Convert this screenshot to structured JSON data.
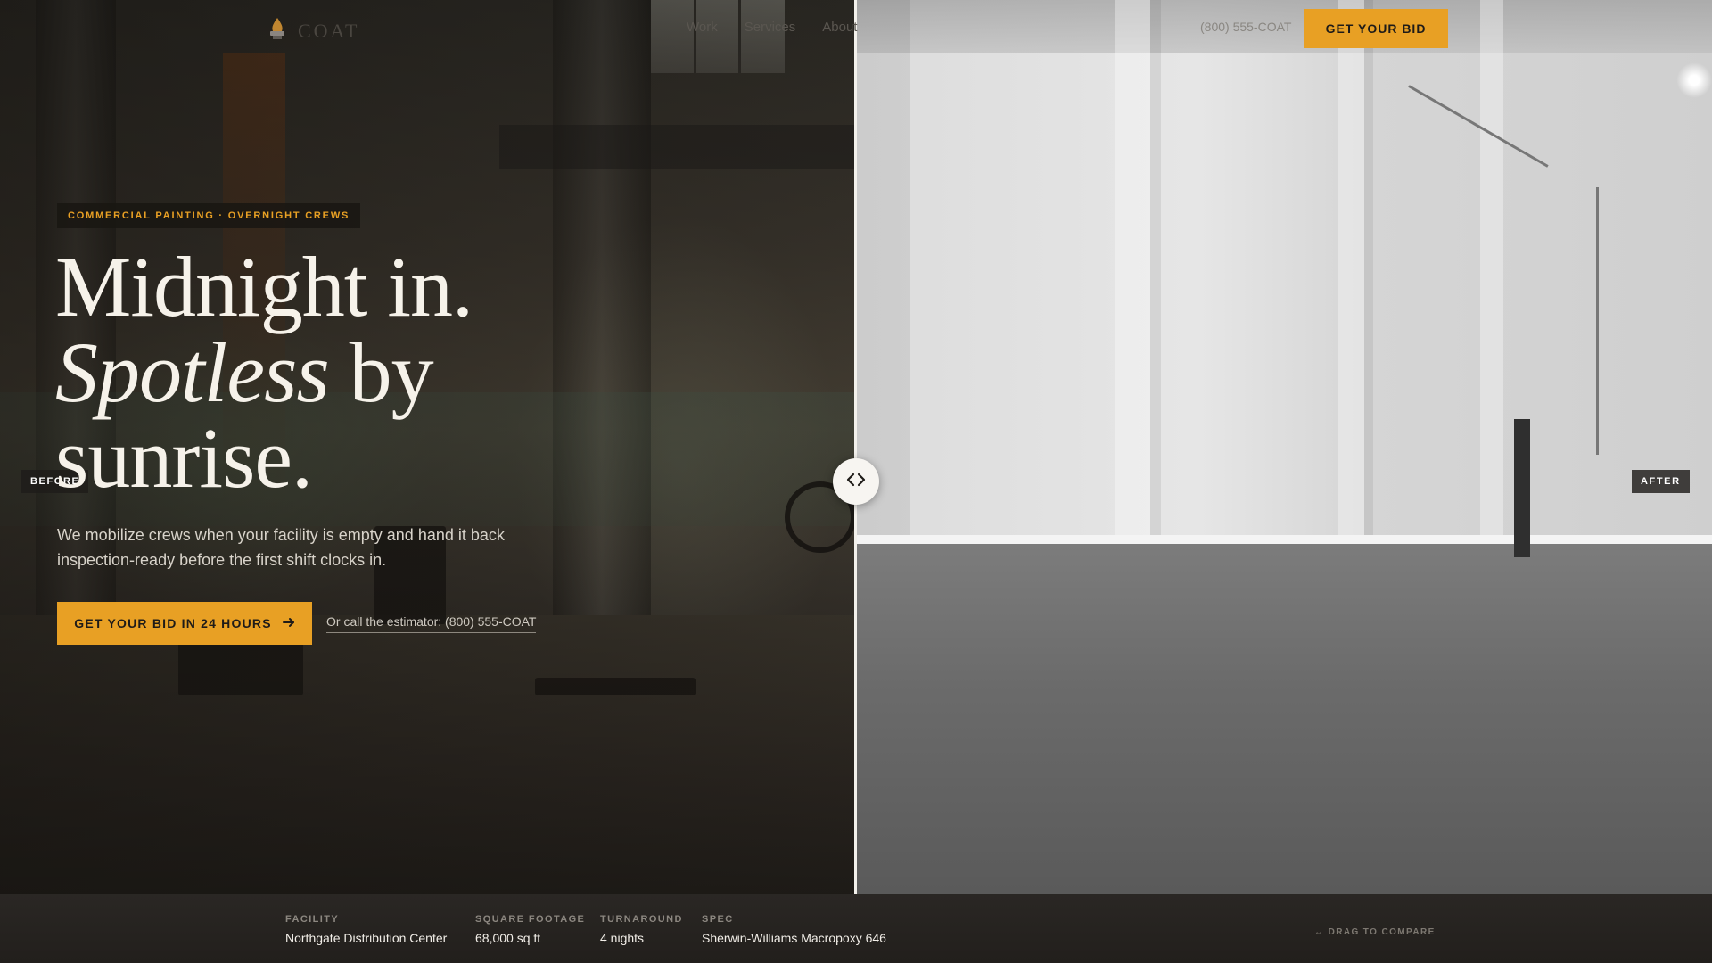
{
  "brand": {
    "name": "COAT",
    "logo_icon": "brush-flame-icon"
  },
  "nav": {
    "items": [
      {
        "label": "Work"
      },
      {
        "label": "Services"
      },
      {
        "label": "About"
      }
    ],
    "phone": "(800) 555-COAT",
    "cta_label": "GET YOUR BID"
  },
  "hero": {
    "eyebrow": "COMMERCIAL PAINTING · OVERNIGHT CREWS",
    "headline_line1": "Midnight in.",
    "headline_italic": "Spotless",
    "headline_line2_rest": " by",
    "headline_line3": "sunrise.",
    "subtext": "We mobilize crews when your facility is empty and hand it back inspection-ready before the first shift clocks in.",
    "cta_label": "GET YOUR BID IN 24 HOURS",
    "call_text": "Or call the estimator: (800) 555-COAT"
  },
  "comparison": {
    "before_label": "BEFORE",
    "after_label": "AFTER",
    "handle_icon": "chevrons-left-right-icon",
    "slider_position_percent": 50
  },
  "specs": [
    {
      "label": "FACILITY",
      "value": "Northgate Distribution Center"
    },
    {
      "label": "SQUARE FOOTAGE",
      "value": "68,000 sq ft"
    },
    {
      "label": "TURNAROUND",
      "value": "4 nights"
    },
    {
      "label": "SPEC",
      "value": "Sherwin-Williams Macropoxy 646"
    }
  ],
  "drag_hint": "↔ DRAG TO COMPARE",
  "colors": {
    "accent": "#e8a024",
    "dark": "#1e1b18",
    "light_text": "#f6f2ea"
  }
}
